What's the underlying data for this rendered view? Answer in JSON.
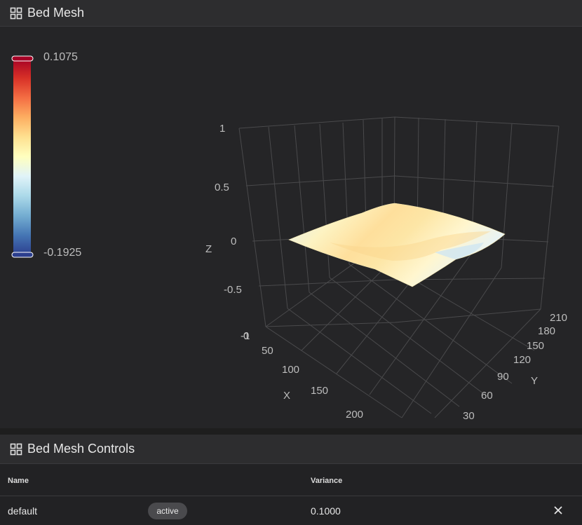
{
  "panels": {
    "mesh_title": "Bed Mesh",
    "controls_title": "Bed Mesh Controls"
  },
  "icons": {
    "panel_header": "grid-icon",
    "remove": "close-icon"
  },
  "colors": {
    "background": "#1e1e1e",
    "header": "#2d2d2f",
    "colorscale": [
      "#2b3e8e",
      "#4575b4",
      "#74add1",
      "#abd9e9",
      "#e0f3f8",
      "#ffffbf",
      "#fee090",
      "#fdae61",
      "#f46d43",
      "#d73027",
      "#a50026"
    ]
  },
  "chart_data": {
    "type": "surface",
    "colorbar": {
      "max_label": "0.1075",
      "min_label": "-0.1925"
    },
    "z_axis": {
      "title": "Z",
      "range": [
        -1,
        1
      ],
      "ticks": [
        "1",
        "0.5",
        "0",
        "-0.5",
        "-1"
      ]
    },
    "x_axis": {
      "title": "X",
      "ticks": [
        "0",
        "50",
        "100",
        "150",
        "200"
      ]
    },
    "y_axis": {
      "title": "Y",
      "ticks": [
        "30",
        "60",
        "90",
        "120",
        "150",
        "180",
        "210"
      ]
    },
    "grid": true
  },
  "table": {
    "headers": {
      "name": "Name",
      "variance": "Variance"
    },
    "rows": [
      {
        "name": "default",
        "status": "active",
        "variance": "0.1000"
      }
    ]
  }
}
